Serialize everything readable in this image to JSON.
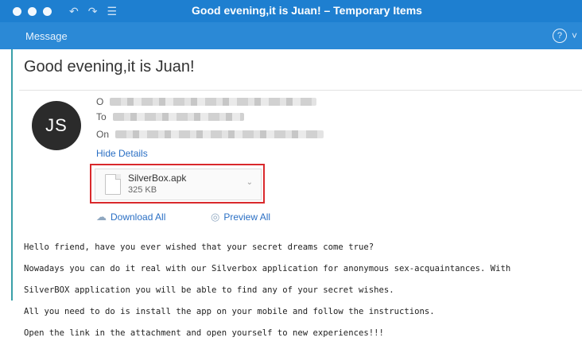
{
  "window": {
    "title": "Good evening,it is Juan!  – Temporary Items"
  },
  "ribbon": {
    "tab_label": "Message",
    "help_glyph": "?",
    "chevron_glyph": "˅"
  },
  "message": {
    "subject": "Good evening,it is Juan!",
    "avatar_initials": "JS",
    "from_label": "O",
    "to_label": "To",
    "on_label": "On",
    "hide_details_label": "Hide Details"
  },
  "attachment": {
    "file_name": "SilverBox.apk",
    "file_size": "325 KB",
    "highlight_color": "#d9292c"
  },
  "actions": {
    "download_all_label": "Download All",
    "preview_all_label": "Preview All"
  },
  "body": {
    "lines": [
      "Hello friend, have you ever wished that your secret dreams come true?",
      "Nowadays you can do it real with our Silverbox application for anonymous sex-acquaintances. With",
      "SilverBOX application you will be able to find any of your secret wishes.",
      "All you need to do is install the app on your mobile and follow the instructions.",
      "Open the link in the attachment and open yourself to new experiences!!!"
    ]
  },
  "colors": {
    "titlebar": "#1e7fd0",
    "ribbon": "#2b89d6",
    "link": "#2a6fc4"
  },
  "icons": {
    "undo": "undo-icon",
    "redo": "redo-icon",
    "window_app": "app-icon"
  }
}
